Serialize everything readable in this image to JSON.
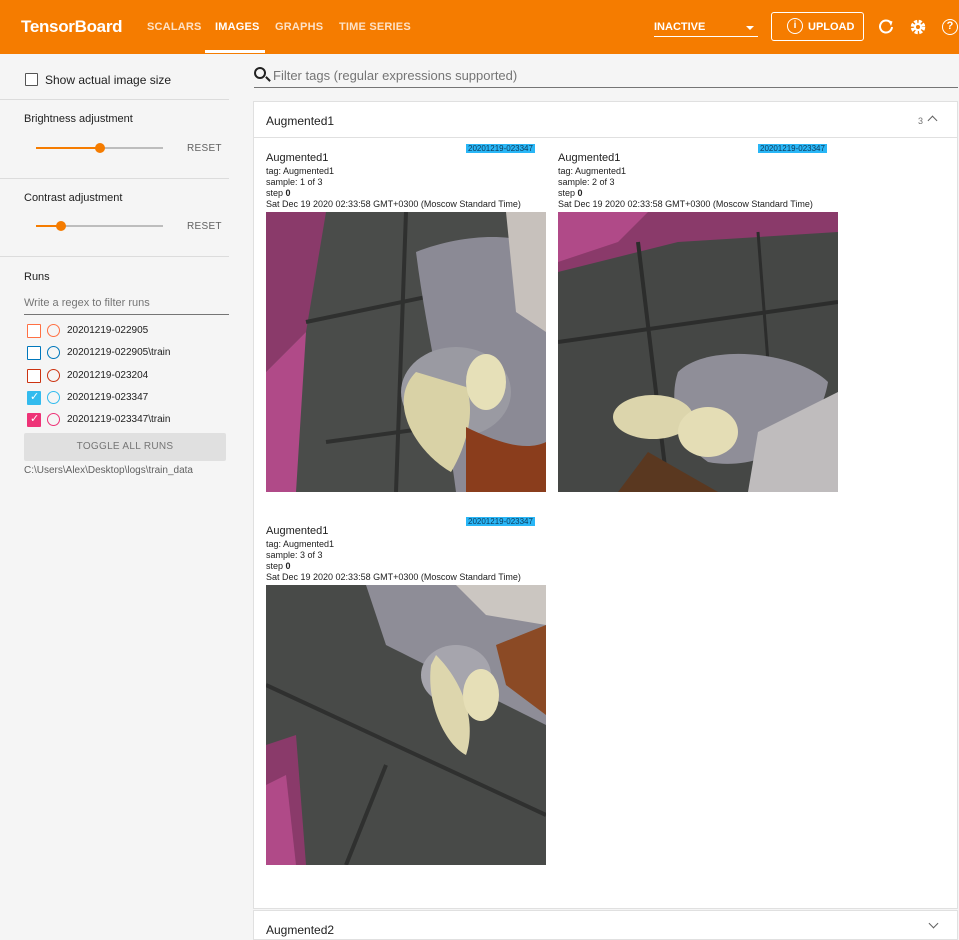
{
  "app": {
    "brand": "TensorBoard"
  },
  "nav": {
    "tabs": [
      {
        "label": "SCALARS"
      },
      {
        "label": "IMAGES"
      },
      {
        "label": "GRAPHS"
      },
      {
        "label": "TIME SERIES"
      }
    ],
    "active_tab": "IMAGES",
    "run_select_value": "INACTIVE",
    "upload_label": "UPLOAD"
  },
  "sidebar": {
    "show_actual_size_label": "Show actual image size",
    "brightness_label": "Brightness adjustment",
    "brightness_value": 0.5,
    "contrast_label": "Contrast adjustment",
    "contrast_value": 0.2,
    "reset_label": "RESET",
    "runs_label": "Runs",
    "runs_filter_placeholder": "Write a regex to filter runs",
    "runs": [
      {
        "name": "20201219-022905",
        "color": "#ff7043",
        "checked": false
      },
      {
        "name": "20201219-022905\\train",
        "color": "#0077bb",
        "checked": false
      },
      {
        "name": "20201219-023204",
        "color": "#cc3311",
        "checked": false
      },
      {
        "name": "20201219-023347",
        "color": "#33bbee",
        "checked": true
      },
      {
        "name": "20201219-023347\\train",
        "color": "#ee3377",
        "checked": true
      }
    ],
    "toggle_all_label": "TOGGLE ALL RUNS",
    "logdir": "C:\\Users\\Alex\\Desktop\\logs\\train_data"
  },
  "main": {
    "filter_placeholder": "Filter tags (regular expressions supported)",
    "sections": [
      {
        "title": "Augmented1",
        "count": "3",
        "expanded": true,
        "images": [
          {
            "title": "Augmented1",
            "tag": "tag: Augmented1",
            "sample": "sample: 1 of 3",
            "step_label": "step ",
            "step": "0",
            "time": "Sat Dec 19 2020 02:33:58 GMT+0300 (Moscow Standard Time)",
            "run": "20201219-023347"
          },
          {
            "title": "Augmented1",
            "tag": "tag: Augmented1",
            "sample": "sample: 2 of 3",
            "step_label": "step ",
            "step": "0",
            "time": "Sat Dec 19 2020 02:33:58 GMT+0300 (Moscow Standard Time)",
            "run": "20201219-023347"
          },
          {
            "title": "Augmented1",
            "tag": "tag: Augmented1",
            "sample": "sample: 3 of 3",
            "step_label": "step ",
            "step": "0",
            "time": "Sat Dec 19 2020 02:33:58 GMT+0300 (Moscow Standard Time)",
            "run": "20201219-023347"
          }
        ]
      },
      {
        "title": "Augmented2",
        "expanded": false
      }
    ]
  },
  "colors": {
    "accent": "#f57c00",
    "run_tag": "#29b6f6"
  }
}
